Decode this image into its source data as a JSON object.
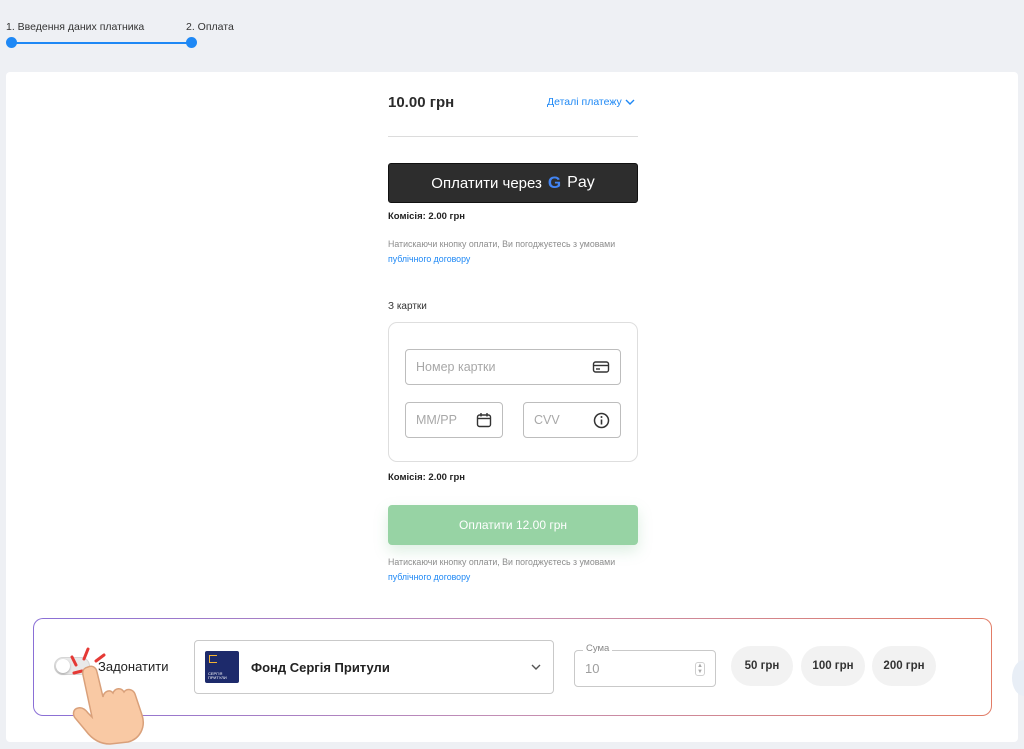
{
  "stepper": {
    "steps": [
      {
        "label": "1. Введення даних платника"
      },
      {
        "label": "2. Оплата"
      }
    ]
  },
  "summary": {
    "amount": "10.00 грн",
    "details_link": "Деталі платежу"
  },
  "gpay": {
    "label": "Оплатити через",
    "g_letter": "G",
    "pay_word": "Pay",
    "fee": "Комісія: 2.00 грн",
    "terms_text": "Натискаючи кнопку оплати, Ви погоджуєтесь з умовами",
    "terms_link": "публічного договору"
  },
  "card_form": {
    "section_label": "З картки",
    "card_number_placeholder": "Номер картки",
    "expiry_placeholder": "ММ/РР",
    "cvv_placeholder": "CVV",
    "fee": "Комісія: 2.00 грн",
    "pay_button": "Оплатити 12.00 грн",
    "terms_text": "Натискаючи кнопку оплати, Ви погоджуєтесь з умовами",
    "terms_link": "публічного договору"
  },
  "donation": {
    "toggle_label": "Задонатити",
    "toggle_on": false,
    "fund_name": "Фонд Сергія Притули",
    "fund_logo_text": "СЕРГІЯ ПРИТУЛИ",
    "sum_label": "Сума",
    "sum_value": "10",
    "chips": [
      "50 грн",
      "100 грн",
      "200 грн"
    ]
  },
  "colors": {
    "accent": "#1e88f5",
    "pay_button": "#97d3a4",
    "gpay_button": "#2d2d2d",
    "fund_logo": "#1d2a6b"
  }
}
